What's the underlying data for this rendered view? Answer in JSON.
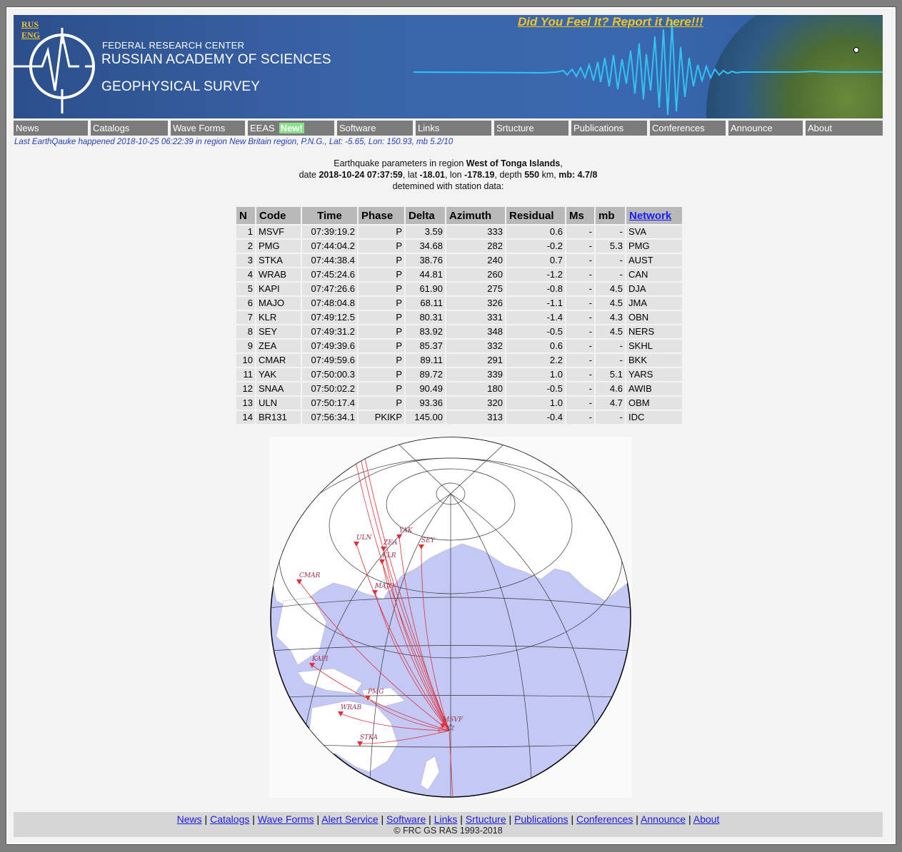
{
  "lang": {
    "rus": "RUS",
    "eng": "ENG"
  },
  "banner": {
    "feel_link": "Did You Feel It? Report it here!!!",
    "org_line1": "FEDERAL RESEARCH CENTER",
    "org_line2": "RUSSIAN ACADEMY OF SCIENCES",
    "org_line3": "GEOPHYSICAL SURVEY"
  },
  "menu": {
    "items": [
      "News",
      "Catalogs",
      "Wave Forms",
      "EEAS",
      "Software",
      "Links",
      "Srtucture",
      "Publications",
      "Conferences",
      "Announce",
      "About"
    ],
    "new_badge": "New!"
  },
  "last_quake": "Last EarthQauke happened 2018-10-25 06:22:39 in region New Britain region, P.N.G., Lat: -5.65, Lon: 150.93, mb 5.2/10",
  "params": {
    "intro": "Earthquake parameters in region",
    "region": "West of Tonga Islands",
    "date_label": "date",
    "datetime": "2018-10-24 07:37:59",
    "lat_label": ", lat",
    "lat": "-18.01",
    "lon_label": ", lon",
    "lon": "-178.19",
    "depth_label": ", depth",
    "depth": "550",
    "depth_unit": "km,",
    "mb_label": "mb: 4.7/8",
    "line3": "detemined with station data:"
  },
  "table": {
    "headers": [
      "N",
      "Code",
      "Time",
      "Phase",
      "Delta",
      "Azimuth",
      "Residual",
      "Ms",
      "mb",
      "Network"
    ],
    "rows": [
      [
        "1",
        "MSVF",
        "07:39:19.2",
        "P",
        "3.59",
        "333",
        "0.6",
        "-",
        "-",
        "SVA"
      ],
      [
        "2",
        "PMG",
        "07:44:04.2",
        "P",
        "34.68",
        "282",
        "-0.2",
        "-",
        "5.3",
        "PMG"
      ],
      [
        "3",
        "STKA",
        "07:44:38.4",
        "P",
        "38.76",
        "240",
        "0.7",
        "-",
        "-",
        "AUST"
      ],
      [
        "4",
        "WRAB",
        "07:45:24.6",
        "P",
        "44.81",
        "260",
        "-1.2",
        "-",
        "-",
        "CAN"
      ],
      [
        "5",
        "KAPI",
        "07:47:26.6",
        "P",
        "61.90",
        "275",
        "-0.8",
        "-",
        "4.5",
        "DJA"
      ],
      [
        "6",
        "MAJO",
        "07:48:04.8",
        "P",
        "68.11",
        "326",
        "-1.1",
        "-",
        "4.5",
        "JMA"
      ],
      [
        "7",
        "KLR",
        "07:49:12.5",
        "P",
        "80.31",
        "331",
        "-1.4",
        "-",
        "4.3",
        "OBN"
      ],
      [
        "8",
        "SEY",
        "07:49:31.2",
        "P",
        "83.92",
        "348",
        "-0.5",
        "-",
        "4.5",
        "NERS"
      ],
      [
        "9",
        "ZEA",
        "07:49:39.6",
        "P",
        "85.37",
        "332",
        "0.6",
        "-",
        "-",
        "SKHL"
      ],
      [
        "10",
        "CMAR",
        "07:49:59.6",
        "P",
        "89.11",
        "291",
        "2.2",
        "-",
        "-",
        "BKK"
      ],
      [
        "11",
        "YAK",
        "07:50:00.3",
        "P",
        "89.72",
        "339",
        "1.0",
        "-",
        "5.1",
        "YARS"
      ],
      [
        "12",
        "SNAA",
        "07:50:02.2",
        "P",
        "90.49",
        "180",
        "-0.5",
        "-",
        "4.6",
        "AWIB"
      ],
      [
        "13",
        "ULN",
        "07:50:17.4",
        "P",
        "93.36",
        "320",
        "1.0",
        "-",
        "4.7",
        "OBM"
      ],
      [
        "14",
        "BR131",
        "07:56:34.1",
        "PKIKP",
        "145.00",
        "313",
        "-0.4",
        "-",
        "-",
        "IDC"
      ]
    ]
  },
  "map": {
    "stations": [
      "ULN",
      "YAK",
      "ZEA",
      "SEY",
      "KLR",
      "CMAR",
      "MAJO",
      "KAPI",
      "PMG",
      "WRAB",
      "STKA",
      "MSVF"
    ],
    "ocean_color": "#c4c8f4",
    "land_color": "#ffffff",
    "ray_color": "#e0303a"
  },
  "footer": {
    "links": [
      "News",
      "Catalogs",
      "Wave Forms",
      "Alert Service",
      "Software",
      "Links",
      "Srtucture",
      "Publications",
      "Conferences",
      "Announce",
      "About"
    ],
    "copyright": "© FRC GS RAS 1993-2018"
  }
}
